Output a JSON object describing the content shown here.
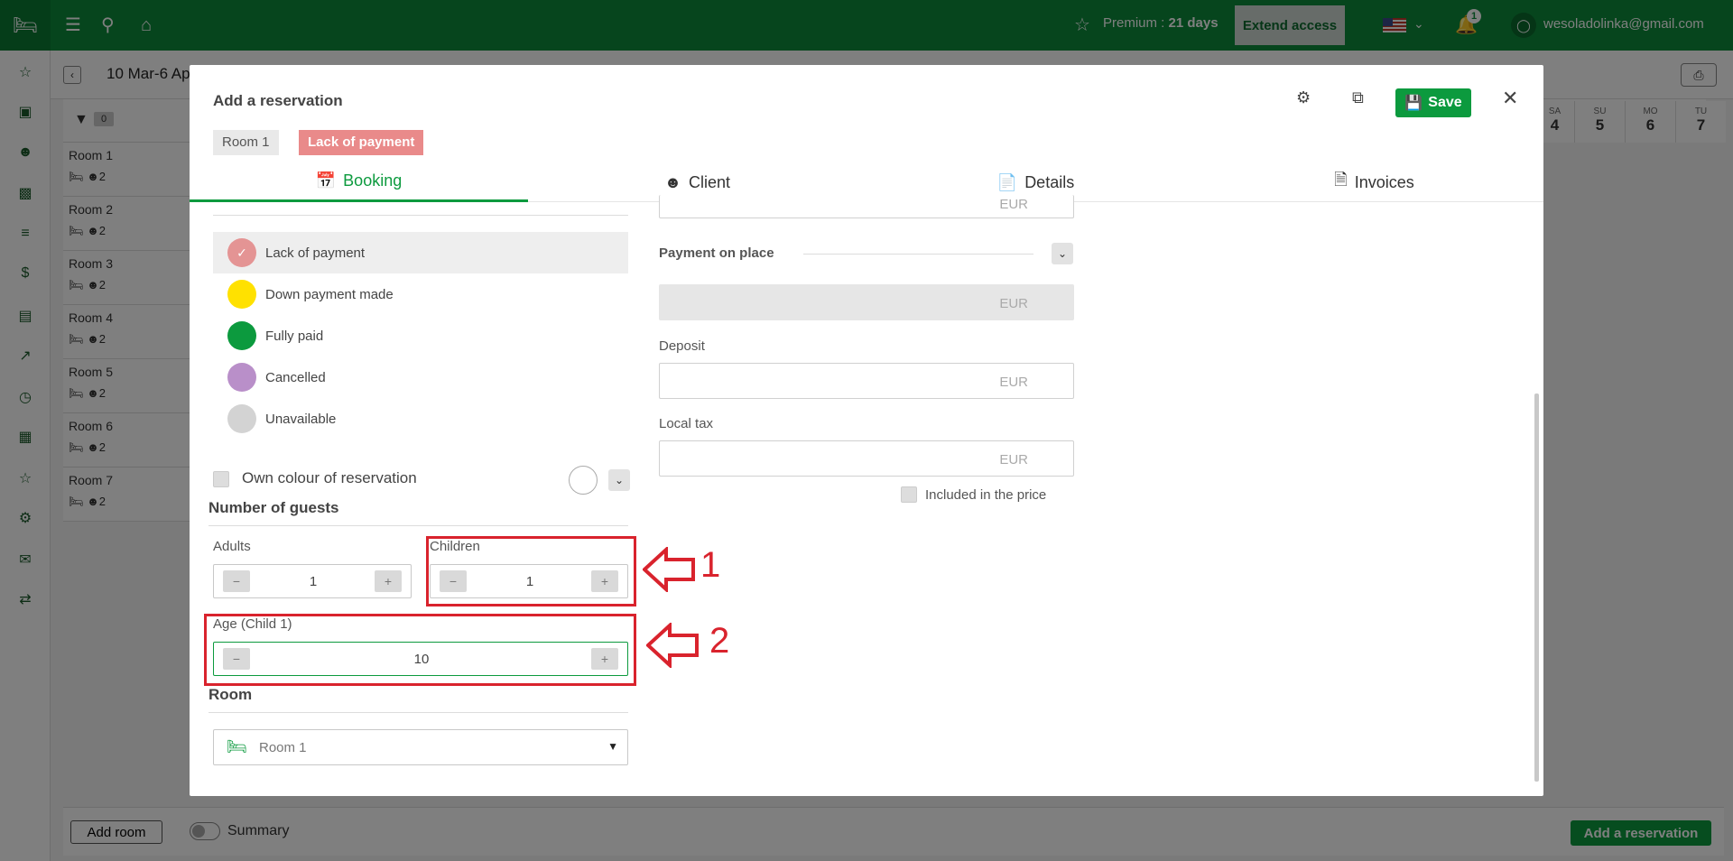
{
  "topbar": {
    "premium_label": "Premium : ",
    "premium_days": "21 days",
    "extend_label": "Extend access",
    "notification_count": "1",
    "user_email": "wesoladolinka@gmail.com"
  },
  "subbar": {
    "date_range": "10 Mar-6 Ap"
  },
  "filter": {
    "count": "0"
  },
  "rooms": [
    {
      "name": "Room 1",
      "guests": "2"
    },
    {
      "name": "Room 2",
      "guests": "2"
    },
    {
      "name": "Room 3",
      "guests": "2"
    },
    {
      "name": "Room 4",
      "guests": "2"
    },
    {
      "name": "Room 5",
      "guests": "2"
    },
    {
      "name": "Room 6",
      "guests": "2"
    },
    {
      "name": "Room 7",
      "guests": "2"
    }
  ],
  "calendar_days": [
    {
      "dn": "SA",
      "dd": "4"
    },
    {
      "dn": "SU",
      "dd": "5"
    },
    {
      "dn": "MO",
      "dd": "6"
    },
    {
      "dn": "TU",
      "dd": "7"
    }
  ],
  "bottombar": {
    "add_room": "Add room",
    "summary": "Summary",
    "add_reservation": "Add a reservation"
  },
  "modal": {
    "title": "Add a reservation",
    "save_label": "Save",
    "tags": {
      "room": "Room 1",
      "status": "Lack of payment"
    },
    "tabs": [
      {
        "label": "Booking",
        "icon": "calendar-icon"
      },
      {
        "label": "Client",
        "icon": "person-icon"
      },
      {
        "label": "Details",
        "icon": "document-icon"
      },
      {
        "label": "Invoices",
        "icon": "invoice-icon"
      }
    ],
    "statuses": [
      {
        "label": "Lack of payment",
        "color": "#e49494"
      },
      {
        "label": "Down payment made",
        "color": "#ffe100"
      },
      {
        "label": "Fully paid",
        "color": "#0c9a3e"
      },
      {
        "label": "Cancelled",
        "color": "#b98fc9"
      },
      {
        "label": "Unavailable",
        "color": "#d3d3d3"
      }
    ],
    "own_colour_label": "Own colour of reservation",
    "guests": {
      "title": "Number of guests",
      "adults_label": "Adults",
      "adults_value": "1",
      "children_label": "Children",
      "children_value": "1",
      "child_age_label": "Age (Child 1)",
      "child_age_value": "10"
    },
    "room": {
      "title": "Room",
      "selected": "Room 1"
    },
    "payment": {
      "top_currency": "EUR",
      "place_title": "Payment on place",
      "place_currency": "EUR",
      "deposit_label": "Deposit",
      "deposit_currency": "EUR",
      "local_tax_label": "Local tax",
      "local_tax_currency": "EUR",
      "included_label": "Included in the price"
    }
  },
  "annotations": {
    "one": "1",
    "two": "2"
  }
}
